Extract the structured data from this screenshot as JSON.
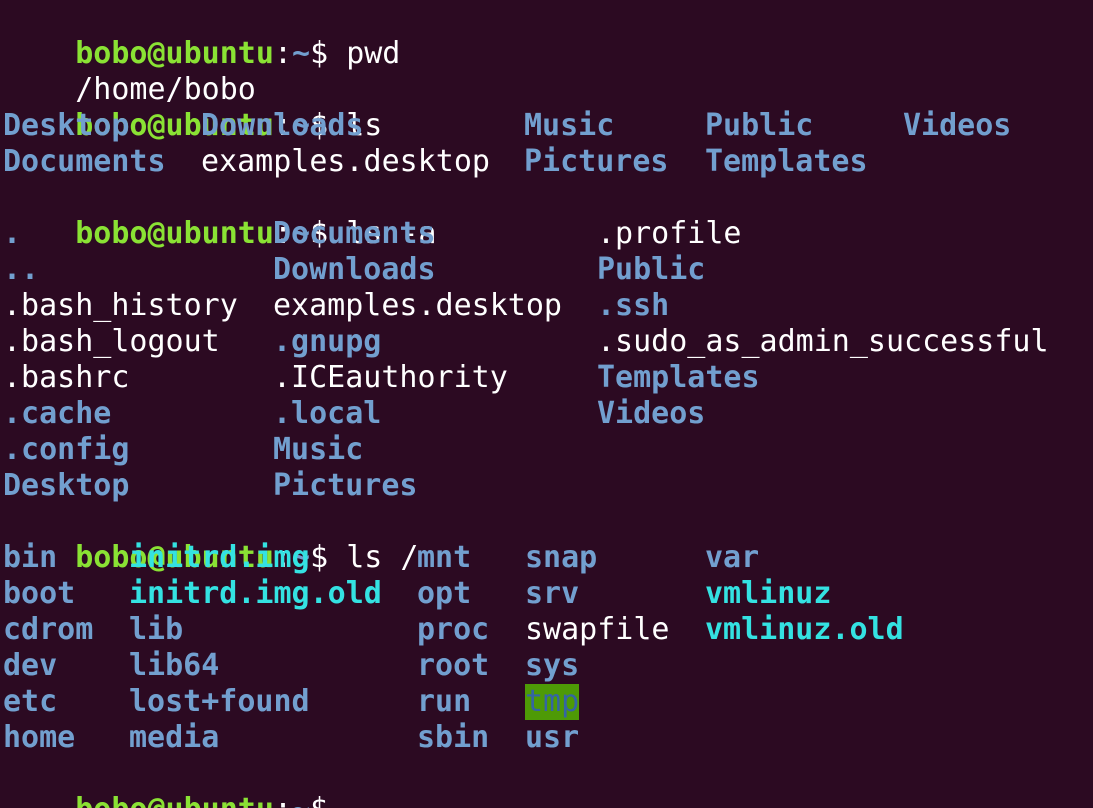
{
  "prompt": {
    "user": "bobo@ubuntu",
    "colon": ":",
    "path": "~",
    "symbol": "$ "
  },
  "commands": {
    "pwd": "pwd",
    "ls": "ls",
    "ls_a": "ls -a",
    "ls_root": "ls /"
  },
  "pwd_output": "/home/bobo",
  "ls_output": {
    "rows": [
      [
        {
          "name": "Desktop",
          "type": "dir"
        },
        {
          "name": "Downloads",
          "type": "dir"
        },
        {
          "name": "Music",
          "type": "dir"
        },
        {
          "name": "Public",
          "type": "dir"
        },
        {
          "name": "Videos",
          "type": "dir"
        }
      ],
      [
        {
          "name": "Documents",
          "type": "dir"
        },
        {
          "name": "examples.desktop",
          "type": "file"
        },
        {
          "name": "Pictures",
          "type": "dir"
        },
        {
          "name": "Templates",
          "type": "dir"
        }
      ]
    ]
  },
  "ls_a_output": {
    "rows": [
      [
        {
          "name": ".",
          "type": "dir"
        },
        {
          "name": "Documents",
          "type": "dir"
        },
        {
          "name": ".profile",
          "type": "file"
        }
      ],
      [
        {
          "name": "..",
          "type": "dir"
        },
        {
          "name": "Downloads",
          "type": "dir"
        },
        {
          "name": "Public",
          "type": "dir"
        }
      ],
      [
        {
          "name": ".bash_history",
          "type": "file"
        },
        {
          "name": "examples.desktop",
          "type": "file"
        },
        {
          "name": ".ssh",
          "type": "dir"
        }
      ],
      [
        {
          "name": ".bash_logout",
          "type": "file"
        },
        {
          "name": ".gnupg",
          "type": "dir"
        },
        {
          "name": ".sudo_as_admin_successful",
          "type": "file"
        }
      ],
      [
        {
          "name": ".bashrc",
          "type": "file"
        },
        {
          "name": ".ICEauthority",
          "type": "file"
        },
        {
          "name": "Templates",
          "type": "dir"
        }
      ],
      [
        {
          "name": ".cache",
          "type": "dir"
        },
        {
          "name": ".local",
          "type": "dir"
        },
        {
          "name": "Videos",
          "type": "dir"
        }
      ],
      [
        {
          "name": ".config",
          "type": "dir"
        },
        {
          "name": "Music",
          "type": "dir"
        }
      ],
      [
        {
          "name": "Desktop",
          "type": "dir"
        },
        {
          "name": "Pictures",
          "type": "dir"
        }
      ]
    ]
  },
  "ls_root_output": {
    "rows": [
      [
        {
          "name": "bin",
          "type": "dir"
        },
        {
          "name": "initrd.img",
          "type": "link"
        },
        {
          "name": "mnt",
          "type": "dir"
        },
        {
          "name": "snap",
          "type": "dir"
        },
        {
          "name": "var",
          "type": "dir"
        }
      ],
      [
        {
          "name": "boot",
          "type": "dir"
        },
        {
          "name": "initrd.img.old",
          "type": "link"
        },
        {
          "name": "opt",
          "type": "dir"
        },
        {
          "name": "srv",
          "type": "dir"
        },
        {
          "name": "vmlinuz",
          "type": "link"
        }
      ],
      [
        {
          "name": "cdrom",
          "type": "dir"
        },
        {
          "name": "lib",
          "type": "dir"
        },
        {
          "name": "proc",
          "type": "dir"
        },
        {
          "name": "swapfile",
          "type": "file"
        },
        {
          "name": "vmlinuz.old",
          "type": "link"
        }
      ],
      [
        {
          "name": "dev",
          "type": "dir"
        },
        {
          "name": "lib64",
          "type": "dir"
        },
        {
          "name": "root",
          "type": "dir"
        },
        {
          "name": "sys",
          "type": "dir"
        }
      ],
      [
        {
          "name": "etc",
          "type": "dir"
        },
        {
          "name": "lost+found",
          "type": "dir"
        },
        {
          "name": "run",
          "type": "dir"
        },
        {
          "name": "tmp",
          "type": "sticky"
        }
      ],
      [
        {
          "name": "home",
          "type": "dir"
        },
        {
          "name": "media",
          "type": "dir"
        },
        {
          "name": "sbin",
          "type": "dir"
        },
        {
          "name": "usr",
          "type": "dir"
        }
      ]
    ]
  },
  "colors": {
    "background": "#2c0a22",
    "prompt_user": "#8ae234",
    "prompt_path": "#729fcf",
    "directory": "#729fcf",
    "symlink": "#34e2e2",
    "sticky_bg": "#4e9a06",
    "text": "#ffffff"
  }
}
